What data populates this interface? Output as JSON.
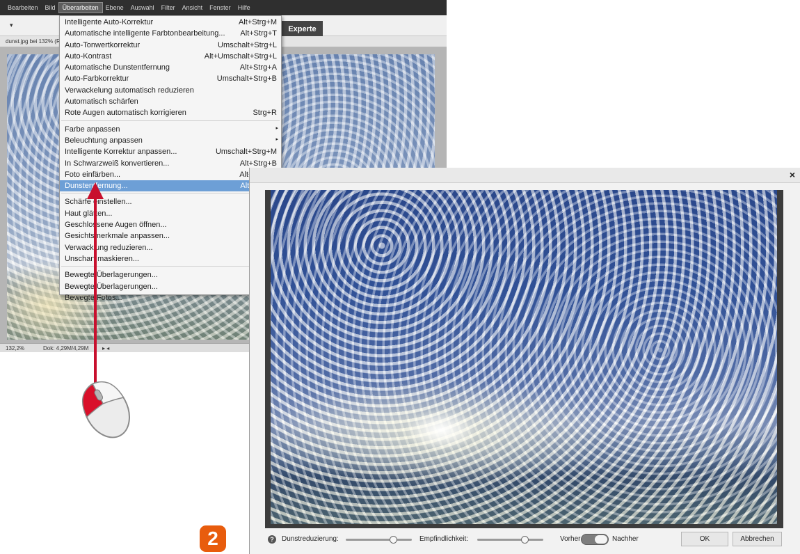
{
  "menubar": {
    "items": [
      "Bearbeiten",
      "Bild",
      "Überarbeiten",
      "Ebene",
      "Auswahl",
      "Filter",
      "Ansicht",
      "Fenster",
      "Hilfe"
    ],
    "active": "Überarbeiten"
  },
  "toolbar": {
    "mode_label": "Experte"
  },
  "document": {
    "tab_title": "dunst.jpg bei 132% (R"
  },
  "statusbar": {
    "zoom": "132,2%",
    "doc_size": "Dok: 4,29M/4,29M"
  },
  "menu": {
    "groups": [
      [
        {
          "label": "Intelligente Auto-Korrektur",
          "shortcut": "Alt+Strg+M"
        },
        {
          "label": "Automatische intelligente Farbtonbearbeitung...",
          "shortcut": "Alt+Strg+T"
        },
        {
          "label": "Auto-Tonwertkorrektur",
          "shortcut": "Umschalt+Strg+L"
        },
        {
          "label": "Auto-Kontrast",
          "shortcut": "Alt+Umschalt+Strg+L"
        },
        {
          "label": "Automatische Dunstentfernung",
          "shortcut": "Alt+Strg+A"
        },
        {
          "label": "Auto-Farbkorrektur",
          "shortcut": "Umschalt+Strg+B"
        },
        {
          "label": "Verwackelung automatisch reduzieren",
          "shortcut": ""
        },
        {
          "label": "Automatisch schärfen",
          "shortcut": ""
        },
        {
          "label": "Rote Augen automatisch korrigieren",
          "shortcut": "Strg+R"
        }
      ],
      [
        {
          "label": "Farbe anpassen",
          "shortcut": "",
          "submenu": true
        },
        {
          "label": "Beleuchtung anpassen",
          "shortcut": "",
          "submenu": true
        },
        {
          "label": "Intelligente Korrektur anpassen...",
          "shortcut": "Umschalt+Strg+M"
        },
        {
          "label": "In Schwarzweiß konvertieren...",
          "shortcut": "Alt+Strg+B"
        },
        {
          "label": "Foto einfärben...",
          "shortcut": "Alt+Strg+R"
        },
        {
          "label": "Dunstentfernung...",
          "shortcut": "Alt+Strg+Z",
          "highlighted": true
        }
      ],
      [
        {
          "label": "Schärfe einstellen...",
          "shortcut": ""
        },
        {
          "label": "Haut glätten...",
          "shortcut": ""
        },
        {
          "label": "Geschlossene Augen öffnen...",
          "shortcut": ""
        },
        {
          "label": "Gesichtsmerkmale anpassen...",
          "shortcut": ""
        },
        {
          "label": "Verwacklung reduzieren...",
          "shortcut": ""
        },
        {
          "label": "Unscharf maskieren...",
          "shortcut": ""
        }
      ],
      [
        {
          "label": "Bewegte Überlagerungen...",
          "shortcut": ""
        },
        {
          "label": "Bewegte Überlagerungen...",
          "shortcut": ""
        },
        {
          "label": "Bewegte Fotos...",
          "shortcut": ""
        }
      ]
    ]
  },
  "step_badge": "2",
  "dialog": {
    "close_glyph": "×",
    "help_glyph": "?",
    "haze_reduction_label": "Dunstreduzierung:",
    "haze_reduction_value": 0.72,
    "sensitivity_label": "Empfindlichkeit:",
    "sensitivity_value": 0.72,
    "before_label": "Vorher",
    "after_label": "Nachher",
    "toggle_state": "Nachher",
    "ok_label": "OK",
    "cancel_label": "Abbrechen"
  },
  "colors": {
    "highlight": "#6d9fd6",
    "arrow": "#c8102e",
    "badge": "#e85c0d"
  }
}
